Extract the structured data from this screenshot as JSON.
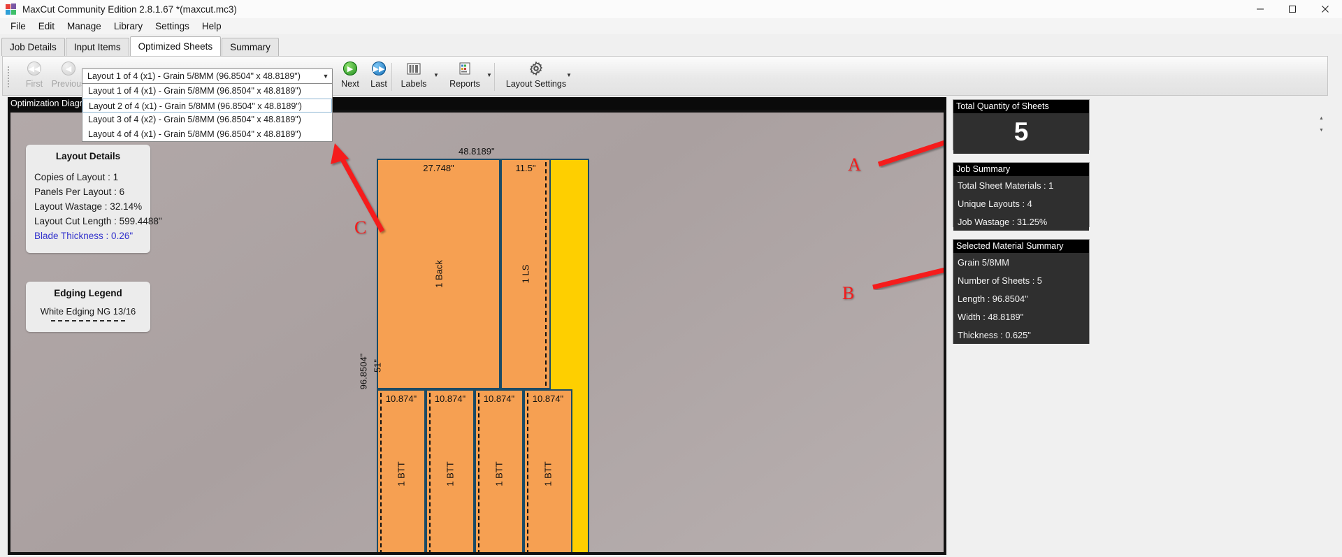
{
  "window": {
    "title": "MaxCut Community Edition 2.8.1.67 *(maxcut.mc3)",
    "minimize": "—",
    "maximize": "❐",
    "close": "✕"
  },
  "menu": {
    "items": [
      "File",
      "Edit",
      "Manage",
      "Library",
      "Settings",
      "Help"
    ]
  },
  "tabs": [
    {
      "label": "Job Details",
      "active": false
    },
    {
      "label": "Input Items",
      "active": false
    },
    {
      "label": "Optimized Sheets",
      "active": true
    },
    {
      "label": "Summary",
      "active": false
    }
  ],
  "toolbar": {
    "first_label": "First",
    "previous_label": "Previous",
    "next_label": "Next",
    "last_label": "Last",
    "labels_label": "Labels",
    "reports_label": "Reports",
    "layout_settings_label": "Layout Settings"
  },
  "layout_combo": {
    "value": "Layout 1 of 4 (x1) - Grain 5/8MM (96.8504\" x 48.8189\")",
    "options": [
      "Layout 1 of 4 (x1) - Grain 5/8MM (96.8504\" x 48.8189\")",
      "Layout 2 of 4 (x1) - Grain 5/8MM (96.8504\" x 48.8189\")",
      "Layout 3 of 4 (x2) - Grain 5/8MM (96.8504\" x 48.8189\")",
      "Layout 4 of 4 (x1) - Grain 5/8MM (96.8504\" x 48.8189\")"
    ],
    "selected_index": 1
  },
  "diagram_pane": {
    "header": "Optimization Diagram"
  },
  "layout_details": {
    "title": "Layout Details",
    "rows": [
      "Copies of Layout :  1",
      "Panels Per Layout :  6",
      "Layout Wastage :  32.14%",
      "Layout Cut Length :  599.4488\""
    ],
    "blade": "Blade Thickness :  0.26\""
  },
  "edging_legend": {
    "title": "Edging Legend",
    "item": "White Edging NG 13/16"
  },
  "sheet": {
    "top_dim": "48.8189\"",
    "left_dim": "96.8504\"",
    "panels": [
      {
        "dim": "27.748\"",
        "name": "1 Back",
        "side": "51\""
      },
      {
        "dim": "11.5\"",
        "name": "1 LS"
      },
      {
        "dim": "10.874\"",
        "name": "1 BTT"
      },
      {
        "dim": "10.874\"",
        "name": "1 BTT"
      },
      {
        "dim": "10.874\"",
        "name": "1 BTT"
      },
      {
        "dim": "10.874\"",
        "name": "1 BTT"
      }
    ]
  },
  "annotations": [
    {
      "letter": "A"
    },
    {
      "letter": "B"
    },
    {
      "letter": "C"
    }
  ],
  "total_quantity": {
    "title": "Total Quantity of Sheets",
    "value": "5"
  },
  "job_summary": {
    "title": "Job Summary",
    "rows": [
      "Total Sheet Materials :  1",
      "Unique Layouts :  4",
      "Job Wastage :  31.25%"
    ]
  },
  "material_summary": {
    "title": "Selected Material Summary",
    "rows": [
      "Grain 5/8MM",
      "Number of Sheets :  5",
      "Length :  96.8504\"",
      "Width :  48.8189\"",
      "Thickness :  0.625\""
    ]
  },
  "colors": {
    "panel": "#f6a052",
    "waste": "#fecf00",
    "annotation": "#f51b1b",
    "accent_blue": "#3333cc"
  }
}
